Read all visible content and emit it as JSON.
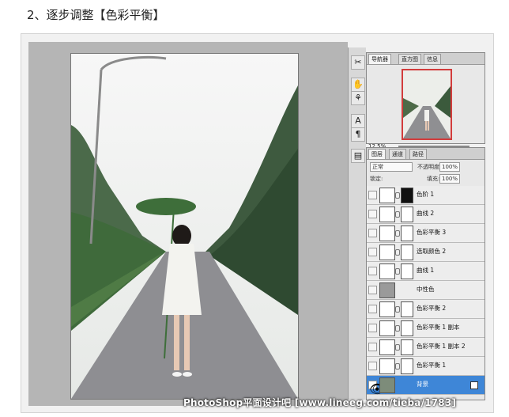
{
  "heading": "2、逐步调整【色彩平衡】",
  "navigator": {
    "tabs": [
      "导航器",
      "直方图",
      "信息"
    ],
    "zoom": "12.5%"
  },
  "layers_panel": {
    "tabs": [
      "图层",
      "通道",
      "路径"
    ],
    "blend_mode": "正常",
    "opacity_label": "不透明度:",
    "opacity_value": "100%",
    "lock_label": "锁定:",
    "fill_label": "填充:",
    "fill_value": "100%",
    "layers": [
      {
        "name": "色阶 1"
      },
      {
        "name": "曲线 2"
      },
      {
        "name": "色彩平衡 3"
      },
      {
        "name": "选取颜色 2"
      },
      {
        "name": "曲线 1"
      },
      {
        "name": "中性色"
      },
      {
        "name": "色彩平衡 2"
      },
      {
        "name": "色彩平衡 1 副本"
      },
      {
        "name": "色彩平衡 1 副本 2"
      },
      {
        "name": "色彩平衡 1"
      },
      {
        "name": "背景"
      }
    ]
  },
  "watermark": "PhotoShop平面设计吧 [www.lineeg.com/tieba/1783]",
  "colors": {
    "selected_layer": "#3e86d7",
    "navigator_frame": "#d23c3c"
  }
}
